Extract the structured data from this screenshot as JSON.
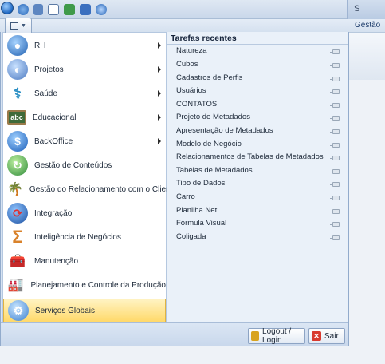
{
  "titlebar": {
    "right_text": "S",
    "icons": [
      "app-orb-icon",
      "refresh-icon",
      "save-icon",
      "window-icon",
      "export-icon",
      "import-icon",
      "help-icon"
    ]
  },
  "ribbon": {
    "tab_gestao": "Gestão"
  },
  "left_menu": {
    "items": [
      {
        "label": "RH",
        "icon": "rh-icon",
        "has_submenu": true
      },
      {
        "label": "Projetos",
        "icon": "projetos-icon",
        "has_submenu": true
      },
      {
        "label": "Saúde",
        "icon": "saude-icon",
        "has_submenu": true
      },
      {
        "label": "Educacional",
        "icon": "educacional-icon",
        "has_submenu": true
      },
      {
        "label": "BackOffice",
        "icon": "backoffice-icon",
        "has_submenu": true
      },
      {
        "label": "Gestão de Conteúdos",
        "icon": "gestao-conteudos-icon",
        "has_submenu": false
      },
      {
        "label": "Gestão do Relacionamento com o Cliente",
        "icon": "crm-icon",
        "has_submenu": false
      },
      {
        "label": "Integração",
        "icon": "integracao-icon",
        "has_submenu": false
      },
      {
        "label": "Inteligência de Negócios",
        "icon": "sigma-icon",
        "has_submenu": false
      },
      {
        "label": "Manutenção",
        "icon": "manutencao-icon",
        "has_submenu": false
      },
      {
        "label": "Planejamento e Controle da Produção",
        "icon": "factory-icon",
        "has_submenu": false
      },
      {
        "label": "Serviços Globais",
        "icon": "servicos-globais-icon",
        "has_submenu": false
      }
    ]
  },
  "recent": {
    "title": "Tarefas recentes",
    "items": [
      "Natureza",
      "Cubos",
      "Cadastros de Perfis",
      "Usuários",
      "CONTATOS",
      "Projeto de Metadados",
      "Apresentação de Metadados",
      "Modelo de Negócio",
      "Relacionamentos de Tabelas de Metadados",
      "Tabelas de Metadados",
      "Tipo de Dados",
      "Carro",
      "Planilha Net",
      "Fórmula Visual",
      "Coligada"
    ]
  },
  "footer": {
    "logout_label": "Logout / Login",
    "exit_label": "Sair"
  },
  "colors": {
    "selected_bg": "#ffd96a",
    "exit_icon": "#d83a2f",
    "logout_icon": "#d8a31f"
  }
}
